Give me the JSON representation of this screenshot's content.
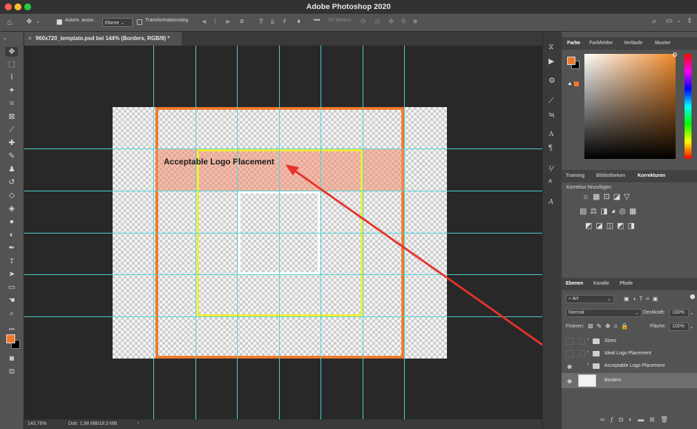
{
  "app": {
    "title": "Adobe Photoshop 2020"
  },
  "options_bar": {
    "auto_select_label": "Autom. ausw.:",
    "auto_select_value": "Ebene",
    "transform_label": "Transformationsstrg.",
    "more_label": "•••",
    "mode_3d_label": "3D-Modus:"
  },
  "document": {
    "tab_title": "960x720_template.psd bei 144% (Borders, RGB/8) *",
    "annotation_text": "Acceptable Logo Placement",
    "colors": {
      "orange_border": "#f07a2a",
      "yellow_border": "#f5ef2c",
      "white_border": "#ffffff",
      "highlight_fill": "#f6a78e",
      "arrow": "#e8322a",
      "guides": "#4fd6d6"
    }
  },
  "status_bar": {
    "zoom": "143,76%",
    "doc_info": "Dok: 1,98 MB/18,5 MB",
    "arrow": "›"
  },
  "color_panel": {
    "tabs": [
      "Farbe",
      "Farbfelder",
      "Verläufe",
      "Muster"
    ],
    "active_tab": "Farbe",
    "foreground_color": "#f07a2a",
    "background_color": "#000000"
  },
  "adjustments_panel": {
    "tabs": [
      "Training",
      "Bibliotheken",
      "Korrekturen"
    ],
    "active_tab": "Korrekturen",
    "add_label": "Korrektur hinzufügen"
  },
  "layers_panel": {
    "tabs": [
      "Ebenen",
      "Kanäle",
      "Pfade"
    ],
    "active_tab": "Ebenen",
    "filter_value": "Art",
    "blend_mode": "Normal",
    "opacity_label": "Deckkraft:",
    "opacity_value": "100%",
    "lock_label": "Fixieren:",
    "fill_label": "Fläche:",
    "fill_value": "100%",
    "layers": [
      {
        "name": "Sizes",
        "type": "group",
        "visible": false
      },
      {
        "name": "Ideal Logo Placement",
        "type": "group",
        "visible": false
      },
      {
        "name": "Acceptable Logo Placement",
        "type": "group",
        "visible": true,
        "highlighted": true
      },
      {
        "name": "Borders",
        "type": "layer",
        "visible": true,
        "selected": true
      }
    ]
  },
  "icons": {
    "move": "✥",
    "marquee": "⬚",
    "lasso": "⌇",
    "wand": "✦",
    "crop": "⌗",
    "frame": "⊠",
    "eyedropper": "⟋",
    "heal": "✚",
    "brush": "✎",
    "stamp": "♟",
    "history": "↺",
    "eraser": "◇",
    "gradient": "◈",
    "blur": "●",
    "dodge": "◐",
    "pen": "✒",
    "type": "T",
    "path-select": "➤",
    "rectangle": "▭",
    "hand": "☚",
    "zoom": "⌕",
    "more": "•••"
  }
}
